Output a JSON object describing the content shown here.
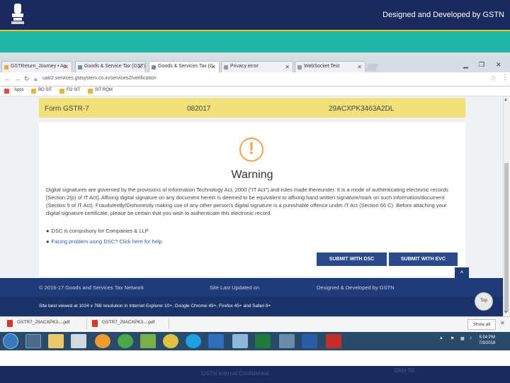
{
  "slide": {
    "credit": "Designed and Developed by GSTN",
    "footer_center": "GSTN Internal Confidential",
    "footer_right": "Slide 59"
  },
  "browser": {
    "tabs": [
      {
        "label": "GSTReturn_Journey • Ap"
      },
      {
        "label": "Goods & Service Tax (GST)"
      },
      {
        "label": "Goods & Services Tax (G"
      },
      {
        "label": "Privacy error"
      },
      {
        "label": "WebSocket Test"
      }
    ],
    "tab_close": "✕",
    "url": "uatr2.services.gstsystem.co.in/services2/verification",
    "bookmarks": [
      "Apps",
      "BO SIT",
      "FO SIT",
      "SIT RQM"
    ]
  },
  "page": {
    "form_name": "Form GSTR-7",
    "period": "082017",
    "gstin": "29ACXPK3463A2DL",
    "warning_title": "Warning",
    "warning_text": "Digital signatures are governed by the provisions of Information Technology Act, 2000 (\"IT Act\") and rules made thereunder. It is a mode of authenticating electronic records [Section 2(p) of IT Act]. Affixing digital signature on any document herein is deemed to be equivalent to affixing hand written signature/mark on such information/document (Section 5 of IT Act). Fraudulently/Dishonestly making use of any other person's digital signature is a punishable offence under IT Act (Section 66 C). Before attaching your digital signature certificate, please be certain that you wish to authenticate this electronic record.",
    "bullet_dsc": "DSC is compulsory for Companies & LLP",
    "bullet_help": "Facing problem using DSC? Click here for help",
    "submit_dsc": "SUBMIT WITH DSC",
    "submit_evc": "SUBMIT WITH EVC",
    "footer_copyright": "© 2016-17 Goods and Services Tax Network",
    "footer_updated": "Site Last Updated on",
    "footer_designed": "Designed & Developed by GSTN",
    "footer_best": "Site best viewed at 1024 x 768 resolution in Internet Explorer 10+, Google Chrome 49+, Firefox 45+ and Safari 6+",
    "top_label": "Top"
  },
  "downloads": {
    "items": [
      "GSTR7_29ACXPK3....pdf",
      "GSTR7_29ACXPK3....pdf"
    ],
    "show_all": "Show all"
  },
  "taskbar": {
    "clock_time": "5:04 PM",
    "clock_date": "7/3/2018"
  }
}
